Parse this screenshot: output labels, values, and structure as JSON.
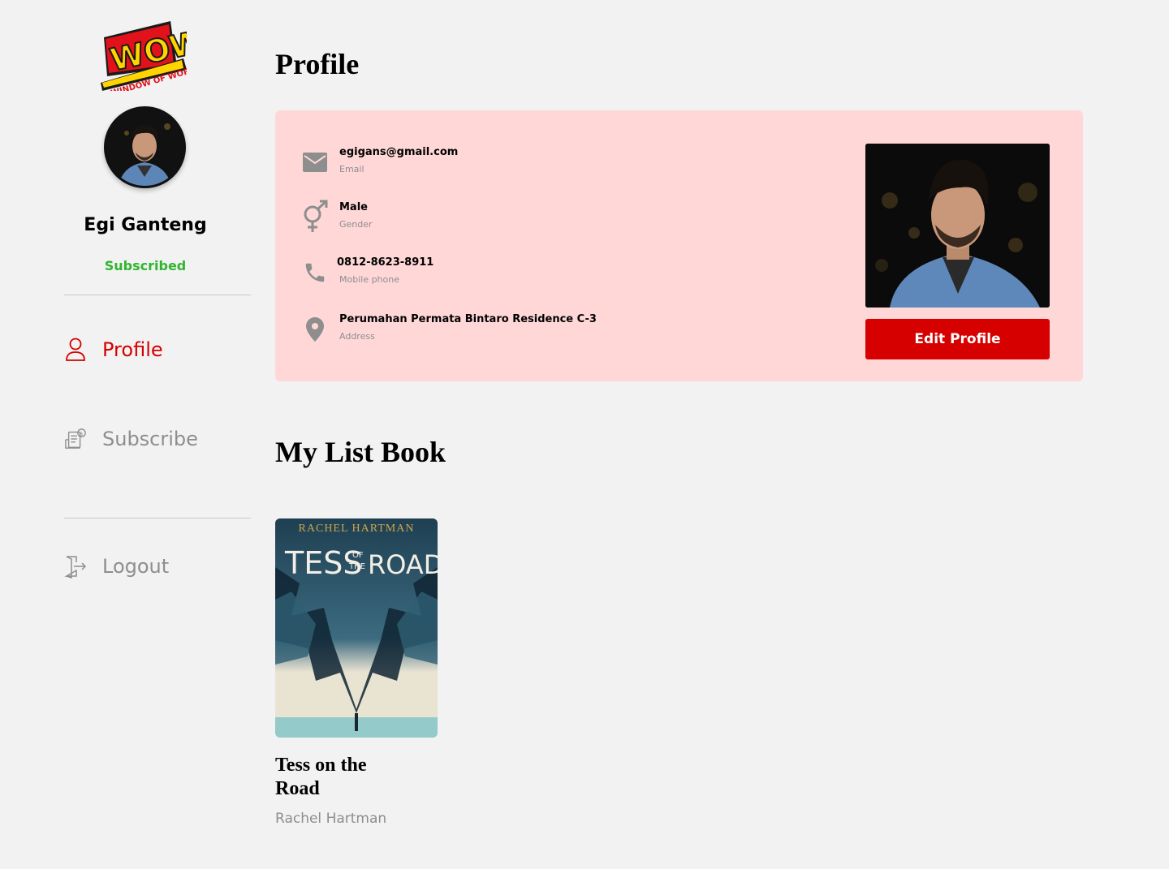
{
  "brand": {
    "logo_top": "WOW",
    "logo_bottom": "WINDOW OF WORLD"
  },
  "user": {
    "name": "Egi Ganteng",
    "status": "Subscribed"
  },
  "nav": {
    "profile": "Profile",
    "subscribe": "Subscribe",
    "logout": "Logout"
  },
  "profile": {
    "heading": "Profile",
    "email": {
      "value": "egigans@gmail.com",
      "label": "Email"
    },
    "gender": {
      "value": "Male",
      "label": "Gender"
    },
    "phone": {
      "value": "0812-8623-8911",
      "label": "Mobile phone"
    },
    "address": {
      "value": "Perumahan Permata Bintaro Residence C-3",
      "label": "Address"
    },
    "edit_button": "Edit Profile"
  },
  "list": {
    "heading": "My List Book",
    "books": [
      {
        "cover_author": "RACHEL HARTMAN",
        "cover_title_left": "TESS",
        "cover_title_mid_top": "OF",
        "cover_title_mid_bottom": "THE",
        "cover_title_right": "ROAD",
        "title": "Tess on the Road",
        "author": "Rachel Hartman"
      }
    ]
  },
  "colors": {
    "accent": "#d60000",
    "status": "#2fb62f",
    "card_bg": "#ffd7d7",
    "page_bg": "#f2f2f2",
    "muted": "#8e8e8e"
  },
  "icons": {
    "email": "mail-icon",
    "gender": "gender-icon",
    "phone": "phone-icon",
    "address": "location-pin-icon",
    "profile": "user-icon",
    "subscribe": "bill-icon",
    "logout": "logout-icon"
  }
}
